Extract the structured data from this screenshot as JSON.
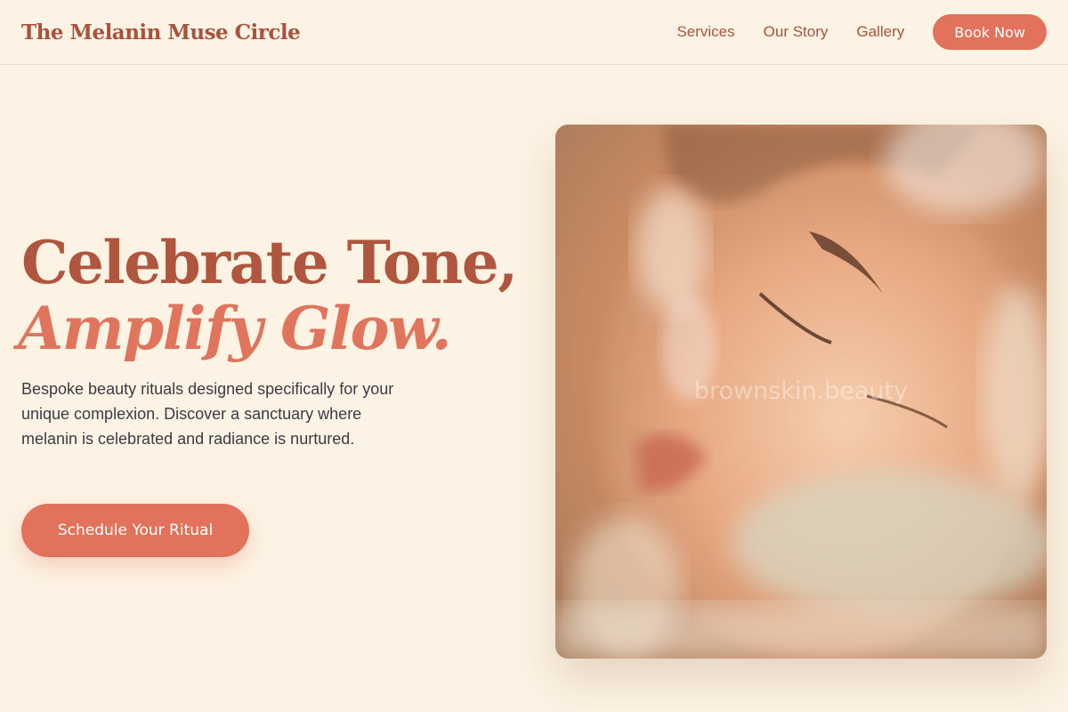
{
  "header": {
    "brand": "The Melanin Muse Circle",
    "nav": [
      "Services",
      "Our Story",
      "Gallery"
    ],
    "book_label": "Book Now"
  },
  "hero": {
    "title_line1": "Celebrate Tone,",
    "title_line2": "Amplify Glow.",
    "description": "Bespoke beauty rituals designed specifically for your unique complexion. Discover a sanctuary where melanin is celebrated and radiance is nurtured.",
    "cta_label": "Schedule Your Ritual",
    "image_watermark": "brownskin.beauty"
  },
  "colors": {
    "background": "#fdf3e4",
    "brand_text": "#a8523c",
    "accent": "#e2725b",
    "body_text": "#3d3a45"
  }
}
